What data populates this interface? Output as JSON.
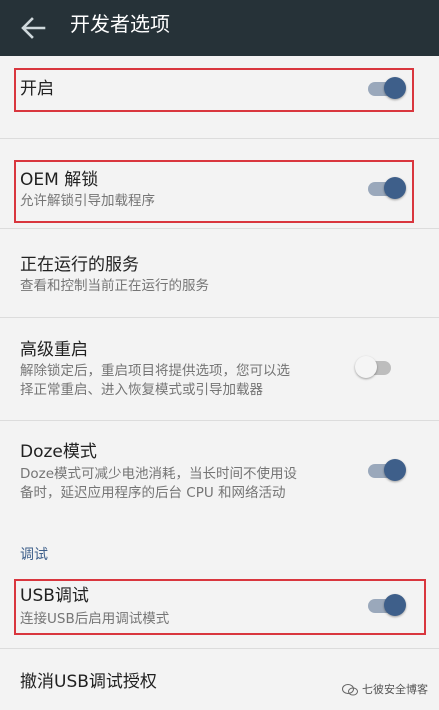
{
  "header": {
    "title": "开发者选项",
    "back_icon": "arrow-left-icon"
  },
  "rows": {
    "enable": {
      "title": "开启",
      "switch": "on"
    },
    "oem_unlock": {
      "title": "OEM 解锁",
      "summary": "允许解锁引导加载程序",
      "switch": "on"
    },
    "running_services": {
      "title": "正在运行的服务",
      "summary": "查看和控制当前正在运行的服务"
    },
    "advanced_reboot": {
      "title": "高级重启",
      "summary_line1": "解除锁定后，重启项目将提供选项，您可以选",
      "summary_line2": "择正常重启、进入恢复模式或引导加载器",
      "switch": "off"
    },
    "doze": {
      "title": "Doze模式",
      "summary_line1": "Doze模式可减少电池消耗，当长时间不使用设",
      "summary_line2": "备时，延迟应用程序的后台 CPU 和网络活动",
      "switch": "on"
    },
    "usb_debugging": {
      "title": "USB调试",
      "summary": "连接USB后启用调试模式",
      "switch": "on"
    },
    "revoke_usb": {
      "title": "撤消USB调试授权"
    }
  },
  "section_debug": {
    "label": "调试"
  },
  "watermark": {
    "text": "七彼安全博客",
    "icon": "wechat-icon"
  },
  "colors": {
    "appbar": "#263238",
    "accent": "#3e5f8a",
    "highlight": "#d9363e",
    "background": "#f3f3f3"
  }
}
